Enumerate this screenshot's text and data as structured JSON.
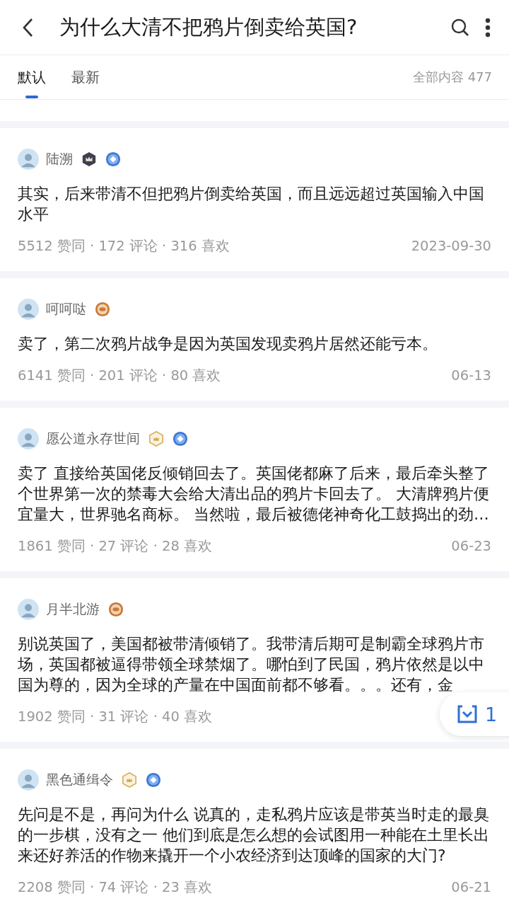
{
  "header": {
    "title": "为什么大清不把鸦片倒卖给英国?"
  },
  "tabs": [
    {
      "label": "默认",
      "selected": true
    },
    {
      "label": "最新",
      "selected": false
    }
  ],
  "total": "全部内容 477",
  "answers": [
    {
      "author": "陆溯",
      "badges": [
        {
          "kind": "hex_dark"
        },
        {
          "kind": "round_blue"
        }
      ],
      "text": "其实，后来带清不但把鸦片倒卖给英国，而且远远超过英国输入中国水平",
      "stats": "5512 赞同 · 172 评论 · 316 喜欢",
      "date": "2023-09-30"
    },
    {
      "author": "呵呵哒",
      "badges": [
        {
          "kind": "round_bronze"
        }
      ],
      "text": "卖了，第二次鸦片战争是因为英国发现卖鸦片居然还能亏本。",
      "stats": "6141 赞同 · 201 评论 · 80 喜欢",
      "date": "06-13"
    },
    {
      "author": "愿公道永存世间",
      "badges": [
        {
          "kind": "hex_gold"
        },
        {
          "kind": "round_blue"
        }
      ],
      "text": "卖了 直接给英国佬反倾销回去了。英国佬都麻了后来，最后牵头整了个世界第一次的禁毒大会给大清出品的鸦片卡回去了。 大清牌鸦片便宜量大，世界驰名商标。 当然啦，最后被德佬神奇化工鼓捣出的劲…",
      "stats": "1861 赞同 · 27 评论 · 28 喜欢",
      "date": "06-23"
    },
    {
      "author": "月半北游",
      "badges": [
        {
          "kind": "round_bronze"
        }
      ],
      "text": "别说英国了，美国都被带清倾销了。我带清后期可是制霸全球鸦片市场，英国都被逼得带领全球禁烟了。哪怕到了民国，鸦片依然是以中国为尊的，因为全球的产量在中国面前都不够看。。。还有，金",
      "stats": "1902 赞同 · 31 评论 · 40 喜欢"
    },
    {
      "author": "黑色通缉令",
      "badges": [
        {
          "kind": "hex_gold"
        },
        {
          "kind": "round_blue"
        }
      ],
      "text": "先问是不是，再问为什么 说真的，走私鸦片应该是带英当时走的最臭的一步棋，没有之一 他们到底是怎么想的会试图用一种能在土里长出来还好养活的作物来撬开一个小农经济到达顶峰的国家的大门?",
      "stats": "2208 赞同 · 74 评论 · 23 喜欢",
      "date": "06-21"
    }
  ],
  "floating_button": {
    "count": "1"
  }
}
